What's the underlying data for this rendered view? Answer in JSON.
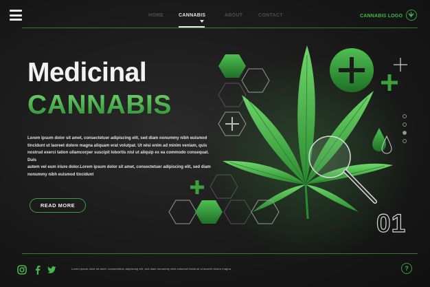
{
  "nav": {
    "items": [
      {
        "label": "HOME"
      },
      {
        "label": "CANNABIS"
      },
      {
        "label": "ABOUT"
      },
      {
        "label": "CONTACT"
      }
    ],
    "active_index": 1
  },
  "logo": {
    "text": "CANNABIS LOGO"
  },
  "hero": {
    "title_line1": "Medicinal",
    "title_line2": "CANNABIS",
    "body_lines": [
      "Lorem ipsum dolor sit amet, consectetuer adipiscing elit, sed diam nonummy nibh euismod",
      "tincidunt ut laoreet dolore magna aliquam erat volutpat. Ut wisi enim ad minim veniam, quis",
      "nostrud exerci tation ullamcorper suscipit lobortis nisl ut aliquip ex ea commodo consequat. Duis",
      "autem vel eum iriure dolor.Lorem ipsum dolor sit amet, consectetuer adipiscing elit, sed diam",
      "nonummy nibh euismod tincidunt"
    ],
    "cta_label": "READ MORE"
  },
  "slider": {
    "current": "01",
    "dot_count": 4,
    "active_dot": 2
  },
  "footer": {
    "text": "Lorem ipsum dolor sit amet, consectetuer adipiscing elit, sed diam nonummy nibh euismod tincidunt ut laoreet dolore magna",
    "social_icons": [
      "instagram-icon",
      "facebook-icon",
      "twitter-icon"
    ],
    "help_label": "?"
  },
  "colors": {
    "background": "#141414",
    "accent": "#3aa13e",
    "accent_light": "#6fd26b",
    "text": "#f2f2f2"
  }
}
